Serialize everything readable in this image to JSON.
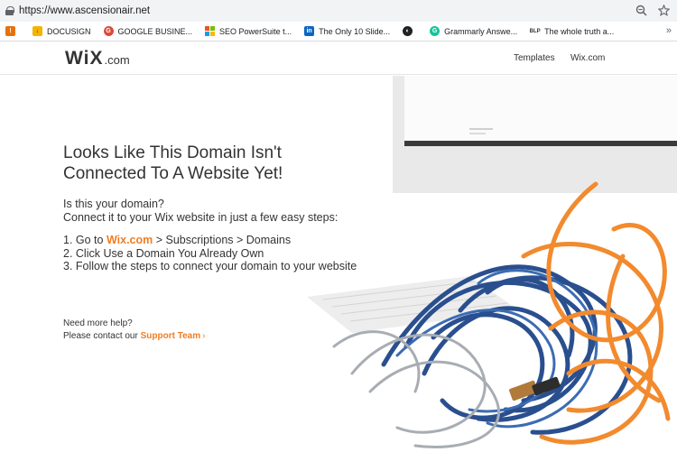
{
  "browser": {
    "url": "https://www.ascensionair.net",
    "bookmarks": [
      {
        "label": "",
        "icon": "alert-bookmark-icon",
        "color": "#e8710a"
      },
      {
        "label": "DOCUSIGN",
        "icon": "docusign-icon",
        "color": "#f4b400"
      },
      {
        "label": "GOOGLE BUSINE...",
        "icon": "google-plus-icon",
        "color": "#dd4b39"
      },
      {
        "label": "SEO PowerSuite t...",
        "icon": "microsoft-grid-icon",
        "color": "#f25022"
      },
      {
        "label": "The Only 10 Slide...",
        "icon": "linkedin-icon",
        "color": "#0a66c2"
      },
      {
        "label": "",
        "icon": "globe-icon",
        "color": "#202124"
      },
      {
        "label": "Grammarly Answe...",
        "icon": "grammarly-icon",
        "color": "#15c39a"
      },
      {
        "label": "The whole truth a...",
        "icon": "bookmark-generic-icon",
        "color": "#333333"
      }
    ],
    "more": "»"
  },
  "header": {
    "logo_main": "WiX",
    "logo_suffix": ".com",
    "nav": [
      "Templates",
      "Wix.com"
    ]
  },
  "content": {
    "headline_line1": "Looks Like This Domain Isn't",
    "headline_line2": "Connected To A Website Yet!",
    "intro_line1": "Is this your domain?",
    "intro_line2": "Connect it to your Wix website in just a few easy steps:",
    "step1_prefix": "1. Go to ",
    "step1_link": "Wix.com",
    "step1_suffix": " > Subscriptions > Domains",
    "step2": "2. Click Use a Domain You Already Own",
    "step3": "3. Follow the steps to connect your domain to your website",
    "help_line1": "Need more help?",
    "help_prefix": "Please contact our ",
    "support_link": "Support Team",
    "support_chevron": "›"
  },
  "colors": {
    "accent": "#f27c21",
    "text": "#333333"
  }
}
